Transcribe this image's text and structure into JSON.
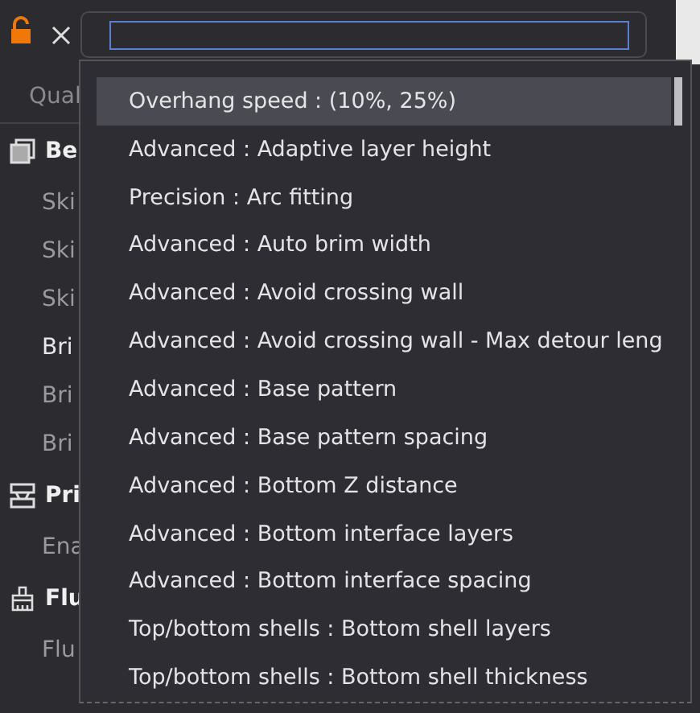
{
  "toolbar": {
    "locked": false
  },
  "sidebar": {
    "tab": "Qual",
    "items": [
      {
        "kind": "header",
        "label": "Be",
        "disabled": false
      },
      {
        "kind": "item",
        "label": "Ski",
        "disabled": true
      },
      {
        "kind": "item",
        "label": "Ski",
        "disabled": true
      },
      {
        "kind": "item",
        "label": "Ski",
        "disabled": true
      },
      {
        "kind": "item",
        "label": "Bri",
        "disabled": false
      },
      {
        "kind": "item",
        "label": "Bri",
        "disabled": true
      },
      {
        "kind": "item",
        "label": "Bri",
        "disabled": true
      },
      {
        "kind": "header",
        "label": "Pri",
        "disabled": false
      },
      {
        "kind": "item",
        "label": "Ena",
        "disabled": true
      },
      {
        "kind": "header",
        "label": "Flu",
        "disabled": false
      },
      {
        "kind": "item",
        "label": "Flu",
        "disabled": true
      }
    ]
  },
  "results": [
    {
      "label": "Overhang speed : (10%, 25%)",
      "selected": true
    },
    {
      "label": "Advanced : Adaptive layer height",
      "selected": false
    },
    {
      "label": "Precision : Arc fitting",
      "selected": false
    },
    {
      "label": "Advanced : Auto brim width",
      "selected": false
    },
    {
      "label": "Advanced : Avoid crossing wall",
      "selected": false
    },
    {
      "label": "Advanced : Avoid crossing wall - Max detour leng",
      "selected": false
    },
    {
      "label": "Advanced : Base pattern",
      "selected": false
    },
    {
      "label": "Advanced : Base pattern spacing",
      "selected": false
    },
    {
      "label": "Advanced : Bottom Z distance",
      "selected": false
    },
    {
      "label": "Advanced : Bottom interface layers",
      "selected": false
    },
    {
      "label": "Advanced : Bottom interface spacing",
      "selected": false
    },
    {
      "label": "Top/bottom shells : Bottom shell layers",
      "selected": false
    },
    {
      "label": "Top/bottom shells : Bottom shell thickness",
      "selected": false
    }
  ]
}
